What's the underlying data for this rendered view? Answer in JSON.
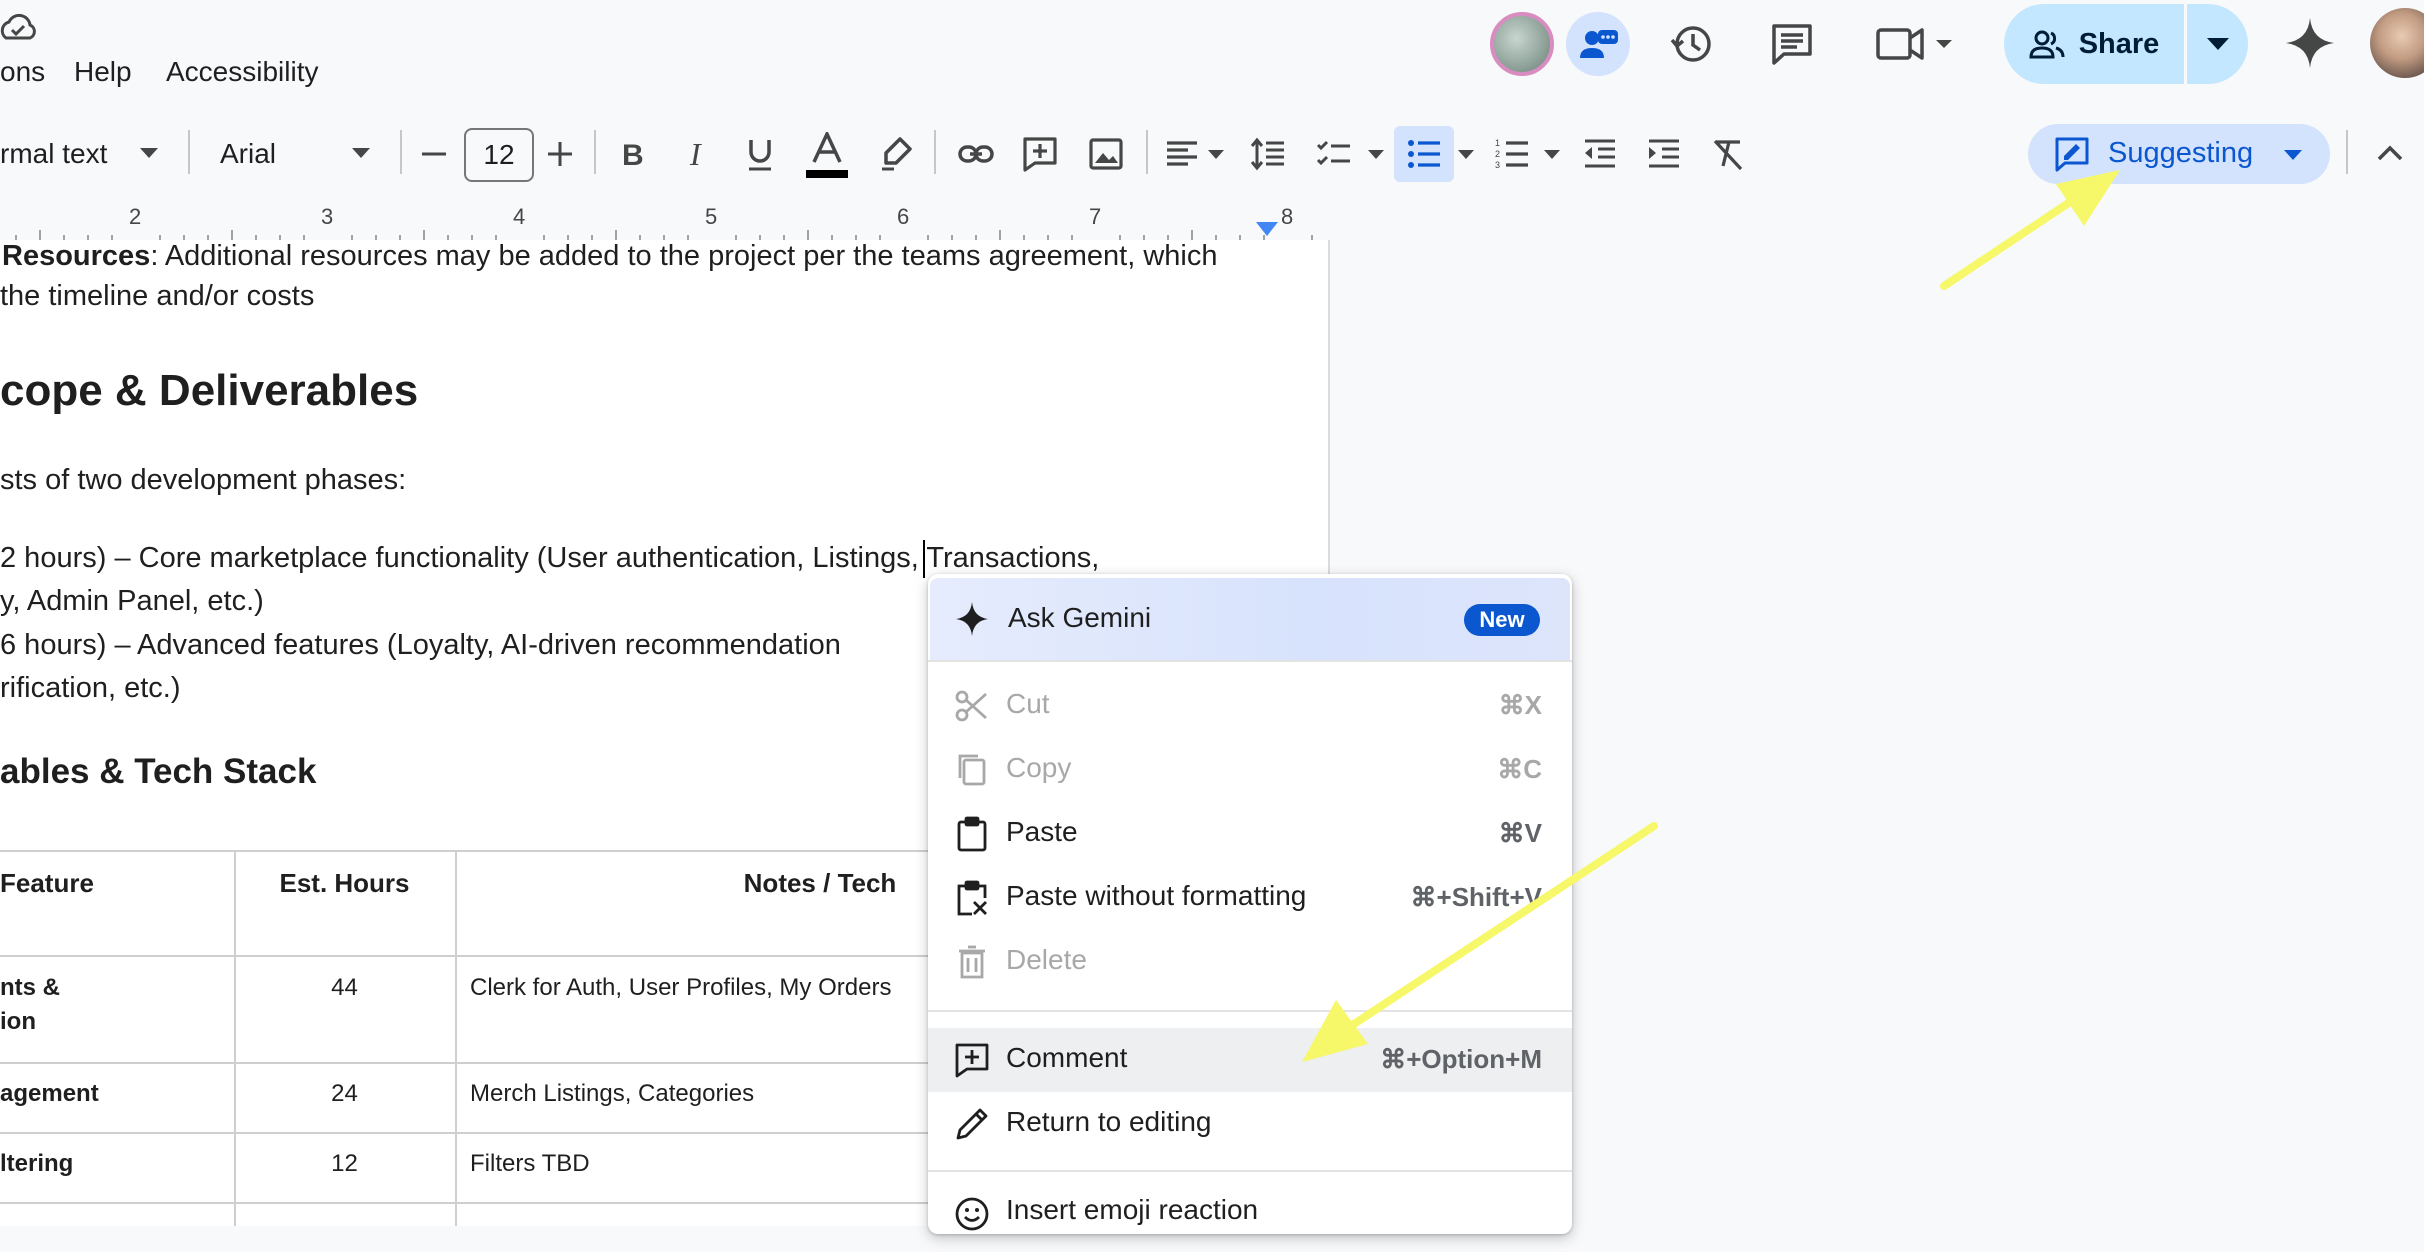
{
  "menu": {
    "items": [
      "ons",
      "Help",
      "Accessibility"
    ]
  },
  "header": {
    "share_label": "Share",
    "icons": [
      "cloud-saved-icon",
      "collaborator-avatar",
      "chat-icon",
      "history-icon",
      "comments-icon",
      "meet-icon",
      "gemini-icon",
      "account-avatar"
    ]
  },
  "toolbar": {
    "style_value": "rmal text",
    "font_value": "Arial",
    "font_size": "12",
    "mode_label": "Suggesting"
  },
  "ruler": {
    "numbers": [
      "2",
      "3",
      "4",
      "5",
      "6",
      "7",
      "8"
    ]
  },
  "document": {
    "line1_bold": "Resources",
    "line1_rest": ": Additional resources may be added to the project per the teams agreement, which",
    "line2": " the timeline and/or costs",
    "heading1": "cope & Deliverables",
    "para1": "sts of two development phases:",
    "phase1_a": "2 hours) – Core marketplace functionality (User authentication, Listings, Transactions,",
    "phase1_b": "y, Admin Panel, etc.)",
    "phase2_a": "6 hours) – Advanced features (Loyalty, AI-driven recommendation",
    "phase2_b": "rification, etc.)",
    "heading2": "ables & Tech Stack",
    "table": {
      "headers": [
        "Feature",
        "Est. Hours",
        "Notes / Tech"
      ],
      "rows": [
        {
          "feature_a": "nts &",
          "feature_b": "ion",
          "hours": "44",
          "notes": "Clerk for Auth, User Profiles, My Orders"
        },
        {
          "feature_a": "agement",
          "feature_b": "",
          "hours": "24",
          "notes": "Merch Listings, Categories"
        },
        {
          "feature_a": "ltering",
          "feature_b": "",
          "hours": "12",
          "notes": "Filters TBD"
        }
      ]
    }
  },
  "context_menu": {
    "gemini_label": "Ask Gemini",
    "new_badge": "New",
    "items": [
      {
        "label": "Cut",
        "shortcut": "⌘X",
        "enabled": false
      },
      {
        "label": "Copy",
        "shortcut": "⌘C",
        "enabled": false
      },
      {
        "label": "Paste",
        "shortcut": "⌘V",
        "enabled": true
      },
      {
        "label": "Paste without formatting",
        "shortcut": "⌘+Shift+V",
        "enabled": true
      },
      {
        "label": "Delete",
        "shortcut": "",
        "enabled": false
      },
      {
        "label": "Comment",
        "shortcut": "⌘+Option+M",
        "enabled": true
      },
      {
        "label": "Return to editing",
        "shortcut": "",
        "enabled": true
      },
      {
        "label": "Insert emoji reaction",
        "shortcut": "",
        "enabled": true
      }
    ]
  },
  "colors": {
    "share_bg": "#c2e7ff",
    "suggest_bg": "#d3e3fd",
    "accent_blue": "#0b57d0",
    "annotation_arrow": "#f7f76a"
  }
}
